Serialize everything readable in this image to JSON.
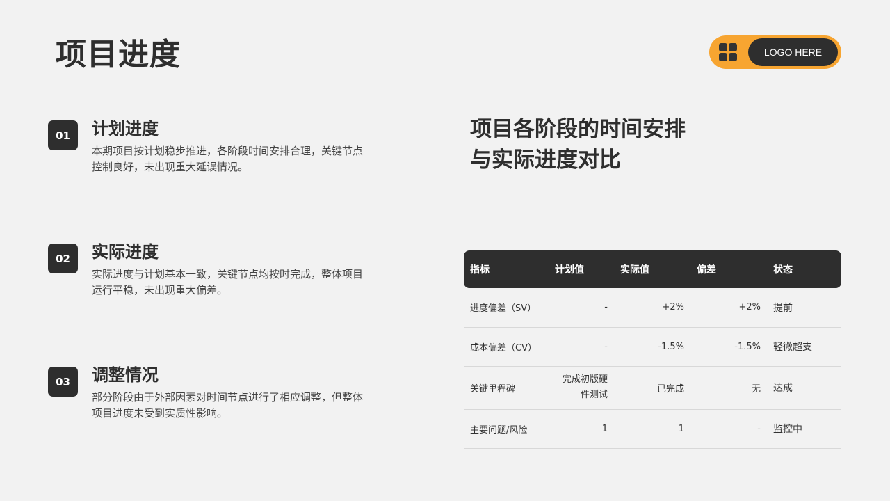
{
  "header": {
    "title": "项目进度",
    "logo_text": "LOGO HERE"
  },
  "items": [
    {
      "num": "01",
      "title": "计划进度",
      "desc": "本期项目按计划稳步推进，各阶段时间安排合理，关键节点控制良好，未出现重大延误情况。"
    },
    {
      "num": "02",
      "title": "实际进度",
      "desc": "实际进度与计划基本一致，关键节点均按时完成，整体项目运行平稳，未出现重大偏差。"
    },
    {
      "num": "03",
      "title": "调整情况",
      "desc": "部分阶段由于外部因素对时间节点进行了相应调整，但整体项目进度未受到实质性影响。"
    }
  ],
  "right": {
    "heading_line1": "项目各阶段的时间安排",
    "heading_line2": "与实际进度对比"
  },
  "table": {
    "headers": [
      "指标",
      "计划值",
      "实际值",
      "偏差",
      "状态"
    ],
    "rows": [
      [
        "进度偏差（SV）",
        "-",
        "+2%",
        "+2%",
        "提前"
      ],
      [
        "成本偏差（CV）",
        "-",
        "-1.5%",
        "-1.5%",
        "轻微超支"
      ],
      [
        "关键里程碑",
        "完成初版硬件测试",
        "已完成",
        "无",
        "达成"
      ],
      [
        "主要问题/风险",
        "1",
        "1",
        "-",
        "监控中"
      ]
    ]
  },
  "colors": {
    "accent": "#f7a531",
    "dark": "#2e2e2e",
    "background": "#f2f2f2"
  }
}
